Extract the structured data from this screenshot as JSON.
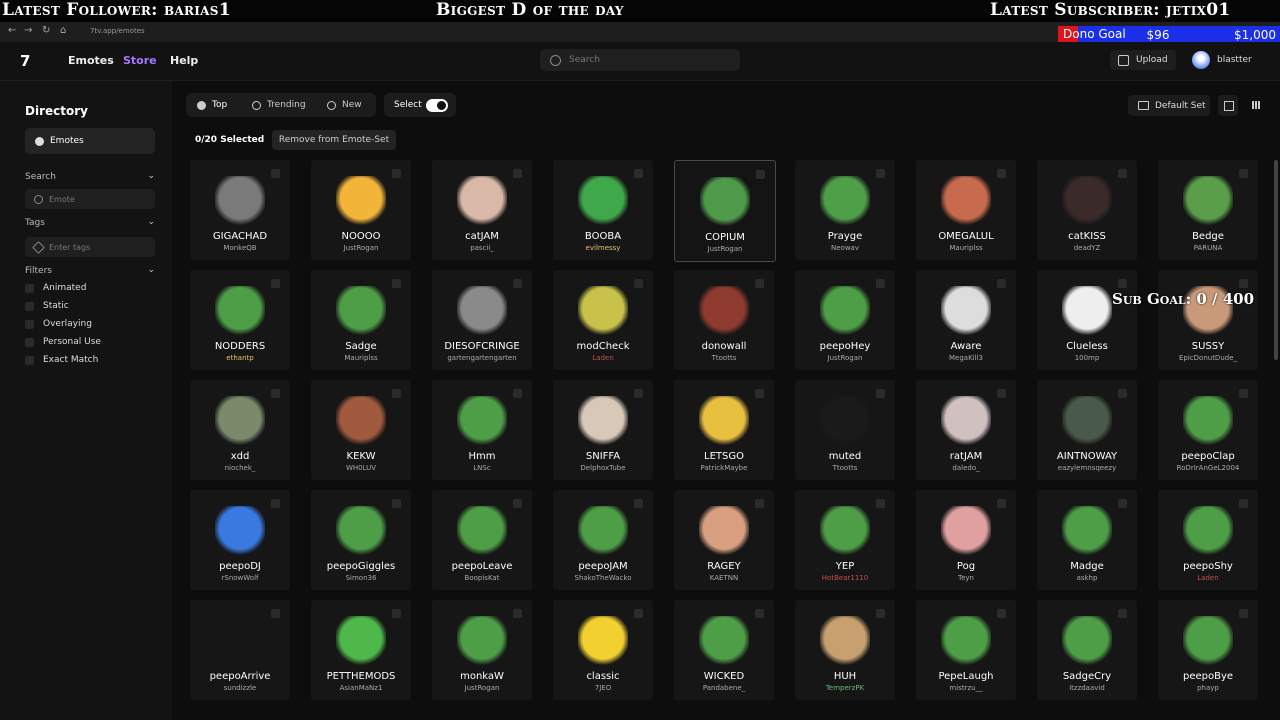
{
  "overlay": {
    "latest_follower": "Latest Follower: barias1",
    "center_text": "Biggest D of the day",
    "latest_subscriber": "Latest Subscriber: jetix01",
    "dono_goal_label": "Dono Goal",
    "dono_current": "$96",
    "dono_target": "$1,000",
    "sub_goal": "Sub Goal: 0 / 400"
  },
  "browser": {
    "url": "7tv.app/emotes"
  },
  "nav": {
    "logo": "7",
    "links": [
      "Emotes",
      "Store",
      "Help"
    ],
    "search_placeholder": "Search",
    "upload": "Upload",
    "username": "blastter"
  },
  "sidebar": {
    "title": "Directory",
    "active_item": "Emotes",
    "search_label": "Search",
    "search_placeholder": "Emote",
    "tags_label": "Tags",
    "tags_placeholder": "Enter tags",
    "filters_label": "Filters",
    "filters": [
      "Animated",
      "Static",
      "Overlaying",
      "Personal Use",
      "Exact Match"
    ]
  },
  "toolbar": {
    "tabs": [
      "Top",
      "Trending",
      "New"
    ],
    "select": "Select",
    "selected_count": "0/20 Selected",
    "remove": "Remove from Emote-Set",
    "default_set": "Default Set"
  },
  "emotes": [
    {
      "name": "GIGACHAD",
      "author": "MonkeQB",
      "color": "#7a7a7a"
    },
    {
      "name": "NOOOO",
      "author": "JustRogan",
      "color": "#f2b53a"
    },
    {
      "name": "catJAM",
      "author": "pascii_",
      "color": "#d9b8a8"
    },
    {
      "name": "BOOBA",
      "author": "evilmessy",
      "author_color": "#e2c36a",
      "color": "#3fa84a"
    },
    {
      "name": "COPIUM",
      "author": "JustRogan",
      "color": "#4e9a4a"
    },
    {
      "name": "Prayge",
      "author": "Neowav",
      "color": "#4f9e48"
    },
    {
      "name": "OMEGALUL",
      "author": "Mauriplss",
      "color": "#c76a4e"
    },
    {
      "name": "catKISS",
      "author": "deadYZ",
      "color": "#3a2a2a"
    },
    {
      "name": "Bedge",
      "author": "PARUNA",
      "color": "#5a9e4a"
    },
    {
      "name": "NODDERS",
      "author": "ethantp",
      "author_color": "#e2c36a",
      "color": "#4e9e48"
    },
    {
      "name": "Sadge",
      "author": "Mauriplss",
      "color": "#4e9e48"
    },
    {
      "name": "DIESOFCRINGE",
      "author": "gartengartengarten",
      "color": "#8a8a8a"
    },
    {
      "name": "modCheck",
      "author": "Laden",
      "author_color": "#c0504d",
      "color": "#c9c24a"
    },
    {
      "name": "donowall",
      "author": "Ttootts",
      "color": "#8e3a2e"
    },
    {
      "name": "peepoHey",
      "author": "JustRogan",
      "color": "#4e9e48"
    },
    {
      "name": "Aware",
      "author": "MegaKill3",
      "color": "#dddddd"
    },
    {
      "name": "Clueless",
      "author": "100mp",
      "color": "#eeeeee"
    },
    {
      "name": "SUSSY",
      "author": "EpicDonutDude_",
      "color": "#c99a7a"
    },
    {
      "name": "xdd",
      "author": "niochek_",
      "color": "#7a8a6a"
    },
    {
      "name": "KEKW",
      "author": "WH0LUV",
      "color": "#a05a3e"
    },
    {
      "name": "Hmm",
      "author": "LNSc",
      "color": "#4e9e48"
    },
    {
      "name": "SNIFFA",
      "author": "DelphoxTube",
      "color": "#d8c8b8"
    },
    {
      "name": "LETSGO",
      "author": "PatrickMaybe",
      "color": "#e8c040"
    },
    {
      "name": "muted",
      "author": "Ttootts",
      "color": "#1a1a1a"
    },
    {
      "name": "ratJAM",
      "author": "daledo_",
      "color": "#d0c0c0"
    },
    {
      "name": "AINTNOWAY",
      "author": "eazylemnsqeezy",
      "color": "#4a5a4a"
    },
    {
      "name": "peepoClap",
      "author": "RoDrIrAnGeL2004",
      "color": "#4e9e48"
    },
    {
      "name": "peepoDJ",
      "author": "rSnowWolf",
      "color": "#3a7ae0"
    },
    {
      "name": "peepoGiggles",
      "author": "Simon36",
      "color": "#4e9e48"
    },
    {
      "name": "peepoLeave",
      "author": "BoopisKat",
      "color": "#4e9e48"
    },
    {
      "name": "peepoJAM",
      "author": "ShakoTheWacko",
      "color": "#4e9e48"
    },
    {
      "name": "RAGEY",
      "author": "KAETNN",
      "color": "#d8a080"
    },
    {
      "name": "YEP",
      "author": "HotBear1110",
      "author_color": "#c0504d",
      "color": "#4e9e48"
    },
    {
      "name": "Pog",
      "author": "Teyn",
      "color": "#e0a0a0"
    },
    {
      "name": "Madge",
      "author": "askhp",
      "color": "#4e9e48"
    },
    {
      "name": "peepoShy",
      "author": "Laden",
      "author_color": "#c0504d",
      "color": "#4e9e48"
    },
    {
      "name": "peepoArrive",
      "author": "sundizzle",
      "color": "#161616"
    },
    {
      "name": "PETTHEMODS",
      "author": "AsianMaNz1",
      "color": "#4eb84a"
    },
    {
      "name": "monkaW",
      "author": "JustRogan",
      "color": "#4e9e48"
    },
    {
      "name": "classic",
      "author": "7JEO",
      "color": "#f2d030"
    },
    {
      "name": "WICKED",
      "author": "Pandabene_",
      "color": "#4e9e48"
    },
    {
      "name": "HUH",
      "author": "TemperzPK",
      "author_color": "#6ab87a",
      "color": "#c8a070"
    },
    {
      "name": "PepeLaugh",
      "author": "mistrzu__",
      "color": "#4e9e48"
    },
    {
      "name": "SadgeCry",
      "author": "itzzdaavid",
      "color": "#4e9e48"
    },
    {
      "name": "peepoBye",
      "author": "phayp",
      "color": "#4e9e48"
    }
  ]
}
